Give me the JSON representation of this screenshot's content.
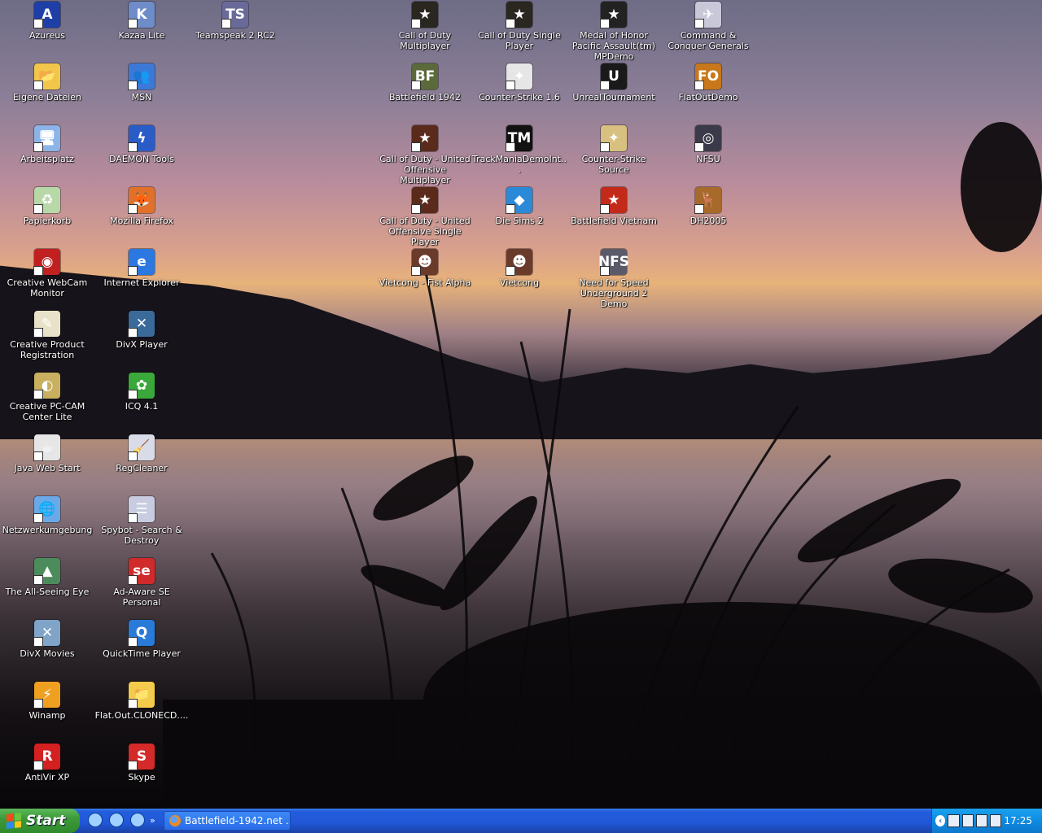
{
  "desktop": {
    "icons": [
      {
        "label": "Azureus",
        "icon": "azureus-icon",
        "color": "#1e3fa8",
        "glyph": "A"
      },
      {
        "label": "Eigene Dateien",
        "icon": "folder-documents-icon",
        "color": "#f2c64b",
        "glyph": "📂"
      },
      {
        "label": "Arbeitsplatz",
        "icon": "my-computer-icon",
        "color": "#8cb4e8",
        "glyph": "🖥"
      },
      {
        "label": "Papierkorb",
        "icon": "recycle-bin-icon",
        "color": "#b9d8a8",
        "glyph": "♻"
      },
      {
        "label": "Creative WebCam Monitor",
        "icon": "webcam-icon",
        "color": "#c02020",
        "glyph": "◉"
      },
      {
        "label": "Creative Product Registration",
        "icon": "registration-icon",
        "color": "#e8e2c8",
        "glyph": "✎"
      },
      {
        "label": "Creative PC-CAM Center Lite",
        "icon": "pccam-icon",
        "color": "#c8b060",
        "glyph": "◐"
      },
      {
        "label": "Java Web Start",
        "icon": "java-icon",
        "color": "#e6e6e6",
        "glyph": "☕"
      },
      {
        "label": "Netzwerkumgebung",
        "icon": "network-icon",
        "color": "#6aa8e8",
        "glyph": "🌐"
      },
      {
        "label": "The All-Seeing Eye",
        "icon": "all-seeing-eye-icon",
        "color": "#4c8c5c",
        "glyph": "▲"
      },
      {
        "label": "DivX Movies",
        "icon": "divx-movies-icon",
        "color": "#7fa4c8",
        "glyph": "✕"
      },
      {
        "label": "Winamp",
        "icon": "winamp-icon",
        "color": "#f0a020",
        "glyph": "⚡"
      },
      {
        "label": "AntiVir XP",
        "icon": "antivir-icon",
        "color": "#d42020",
        "glyph": "R"
      },
      {
        "label": "Kazaa Lite",
        "icon": "kazaa-icon",
        "color": "#6e8cc8",
        "glyph": "K"
      },
      {
        "label": "MSN",
        "icon": "msn-icon",
        "color": "#3c78d8",
        "glyph": "👥"
      },
      {
        "label": "DAEMON Tools",
        "icon": "daemon-tools-icon",
        "color": "#2a5cc8",
        "glyph": "ϟ"
      },
      {
        "label": "Mozilla Firefox",
        "icon": "firefox-icon",
        "color": "#e0702a",
        "glyph": "🦊"
      },
      {
        "label": "Internet Explorer",
        "icon": "internet-explorer-icon",
        "color": "#2a78e0",
        "glyph": "e"
      },
      {
        "label": "DivX Player",
        "icon": "divx-player-icon",
        "color": "#3a6a9a",
        "glyph": "✕"
      },
      {
        "label": "ICQ 4.1",
        "icon": "icq-icon",
        "color": "#3aa83a",
        "glyph": "✿"
      },
      {
        "label": "RegCleaner",
        "icon": "regcleaner-icon",
        "color": "#d8dce8",
        "glyph": "🧹"
      },
      {
        "label": "Spybot - Search & Destroy",
        "icon": "spybot-icon",
        "color": "#c8cce0",
        "glyph": "☰"
      },
      {
        "label": "Ad-Aware SE Personal",
        "icon": "adaware-icon",
        "color": "#d02a2a",
        "glyph": "se"
      },
      {
        "label": "QuickTime Player",
        "icon": "quicktime-icon",
        "color": "#2a7ad8",
        "glyph": "Q"
      },
      {
        "label": "Flat.Out.CLONECD....",
        "icon": "folder-icon",
        "color": "#f2cc4a",
        "glyph": "📁"
      },
      {
        "label": "Skype",
        "icon": "skype-icon",
        "color": "#d42a2a",
        "glyph": "S"
      },
      {
        "label": "Teamspeak 2 RC2",
        "icon": "teamspeak-icon",
        "color": "#6a6a9a",
        "glyph": "TS"
      },
      {
        "label": "Call of Duty Multiplayer",
        "icon": "call-of-duty-icon",
        "color": "#2a2620",
        "glyph": "★"
      },
      {
        "label": "Battlefield 1942",
        "icon": "battlefield-1942-icon",
        "color": "#5a6a3a",
        "glyph": "BF"
      },
      {
        "label": "Call of Duty - United Offensive Multiplayer",
        "icon": "call-of-duty-uo-icon",
        "color": "#5a2a1a",
        "glyph": "★"
      },
      {
        "label": "Call of Duty - United Offensive Single Player",
        "icon": "call-of-duty-uo-sp-icon",
        "color": "#5a2a1a",
        "glyph": "★"
      },
      {
        "label": "Vietcong - Fist Alpha",
        "icon": "vietcong-fist-alpha-icon",
        "color": "#6a3a2a",
        "glyph": "☻"
      },
      {
        "label": "Call of Duty Single Player",
        "icon": "call-of-duty-sp-icon",
        "color": "#2a2620",
        "glyph": "★"
      },
      {
        "label": "Counter-Strike 1.6",
        "icon": "counter-strike-icon",
        "color": "#e6e6e6",
        "glyph": "✦"
      },
      {
        "label": "TrackManiaDemoInt...",
        "icon": "trackmania-icon",
        "color": "#111111",
        "glyph": "TM"
      },
      {
        "label": "Die Sims 2",
        "icon": "sims-2-icon",
        "color": "#2a8ad8",
        "glyph": "◆"
      },
      {
        "label": "Vietcong",
        "icon": "vietcong-icon",
        "color": "#6a3a2a",
        "glyph": "☻"
      },
      {
        "label": "Medal of Honor Pacific Assault(tm) MPDemo",
        "icon": "medal-of-honor-icon",
        "color": "#222222",
        "glyph": "★"
      },
      {
        "label": "UnrealTournament",
        "icon": "unreal-tournament-icon",
        "color": "#1a1a1a",
        "glyph": "U"
      },
      {
        "label": "Counter-Strike Source",
        "icon": "counter-strike-source-icon",
        "color": "#d8c080",
        "glyph": "✦"
      },
      {
        "label": "Battlefield Vietnam",
        "icon": "battlefield-vietnam-icon",
        "color": "#c42a1a",
        "glyph": "★"
      },
      {
        "label": "Need for Speed Underground 2 Demo",
        "icon": "nfs-underground-2-icon",
        "color": "#5a5a6a",
        "glyph": "NFS"
      },
      {
        "label": "Command & Conquer Generals",
        "icon": "command-conquer-icon",
        "color": "#c8c8d8",
        "glyph": "✈"
      },
      {
        "label": "FlatOutDemo",
        "icon": "flatout-icon",
        "color": "#c8781a",
        "glyph": "FO"
      },
      {
        "label": "NFSU",
        "icon": "nfsu-icon",
        "color": "#3a3a4a",
        "glyph": "◎"
      },
      {
        "label": "DH2005",
        "icon": "dh2005-icon",
        "color": "#a86a2a",
        "glyph": "🦌"
      }
    ]
  },
  "taskbar": {
    "start_label": "Start",
    "task_label": "Battlefield-1942.net ...",
    "clock": "17:25",
    "tray_chevron": "‹",
    "quick_more": "»"
  },
  "colors": {
    "taskbar": "#245edb",
    "start": "#3c9a3a",
    "tray": "#0f8ae0"
  }
}
